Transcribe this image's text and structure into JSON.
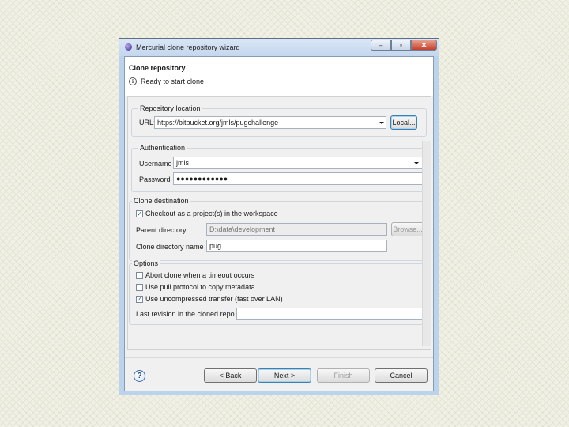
{
  "window": {
    "title": "Mercurial clone repository wizard",
    "controls": {
      "minimize": "–",
      "maximize": "▫",
      "close": "✕"
    }
  },
  "header": {
    "title": "Clone repository",
    "message": "Ready to start clone",
    "icon": "info-icon"
  },
  "repository_location": {
    "group_title": "Repository location",
    "url_label": "URL:",
    "url_value": "https://bitbucket.org/jmls/pugchallenge",
    "local_button": "Local..."
  },
  "authentication": {
    "group_title": "Authentication",
    "username_label": "Username",
    "username_value": "jmls",
    "password_label": "Password",
    "password_value": "●●●●●●●●●●●●"
  },
  "clone_destination": {
    "group_title": "Clone destination",
    "checkout_label": "Checkout as a project(s) in the workspace",
    "checkout_checked": true,
    "parent_dir_label": "Parent directory",
    "parent_dir_value": "D:\\data\\development",
    "browse_button": "Browse...",
    "clone_dir_label": "Clone directory name",
    "clone_dir_value": "pug"
  },
  "options": {
    "group_title": "Options",
    "items": [
      {
        "label": "Abort clone when a timeout occurs",
        "checked": false
      },
      {
        "label": "Use pull protocol to copy metadata",
        "checked": false
      },
      {
        "label": "Use uncompressed transfer (fast over LAN)",
        "checked": true
      }
    ],
    "last_revision_label": "Last revision in the cloned repo",
    "last_revision_value": ""
  },
  "footer": {
    "back": "< Back",
    "next": "Next >",
    "finish": "Finish",
    "cancel": "Cancel",
    "help_icon": "help-icon",
    "help_glyph": "?"
  }
}
